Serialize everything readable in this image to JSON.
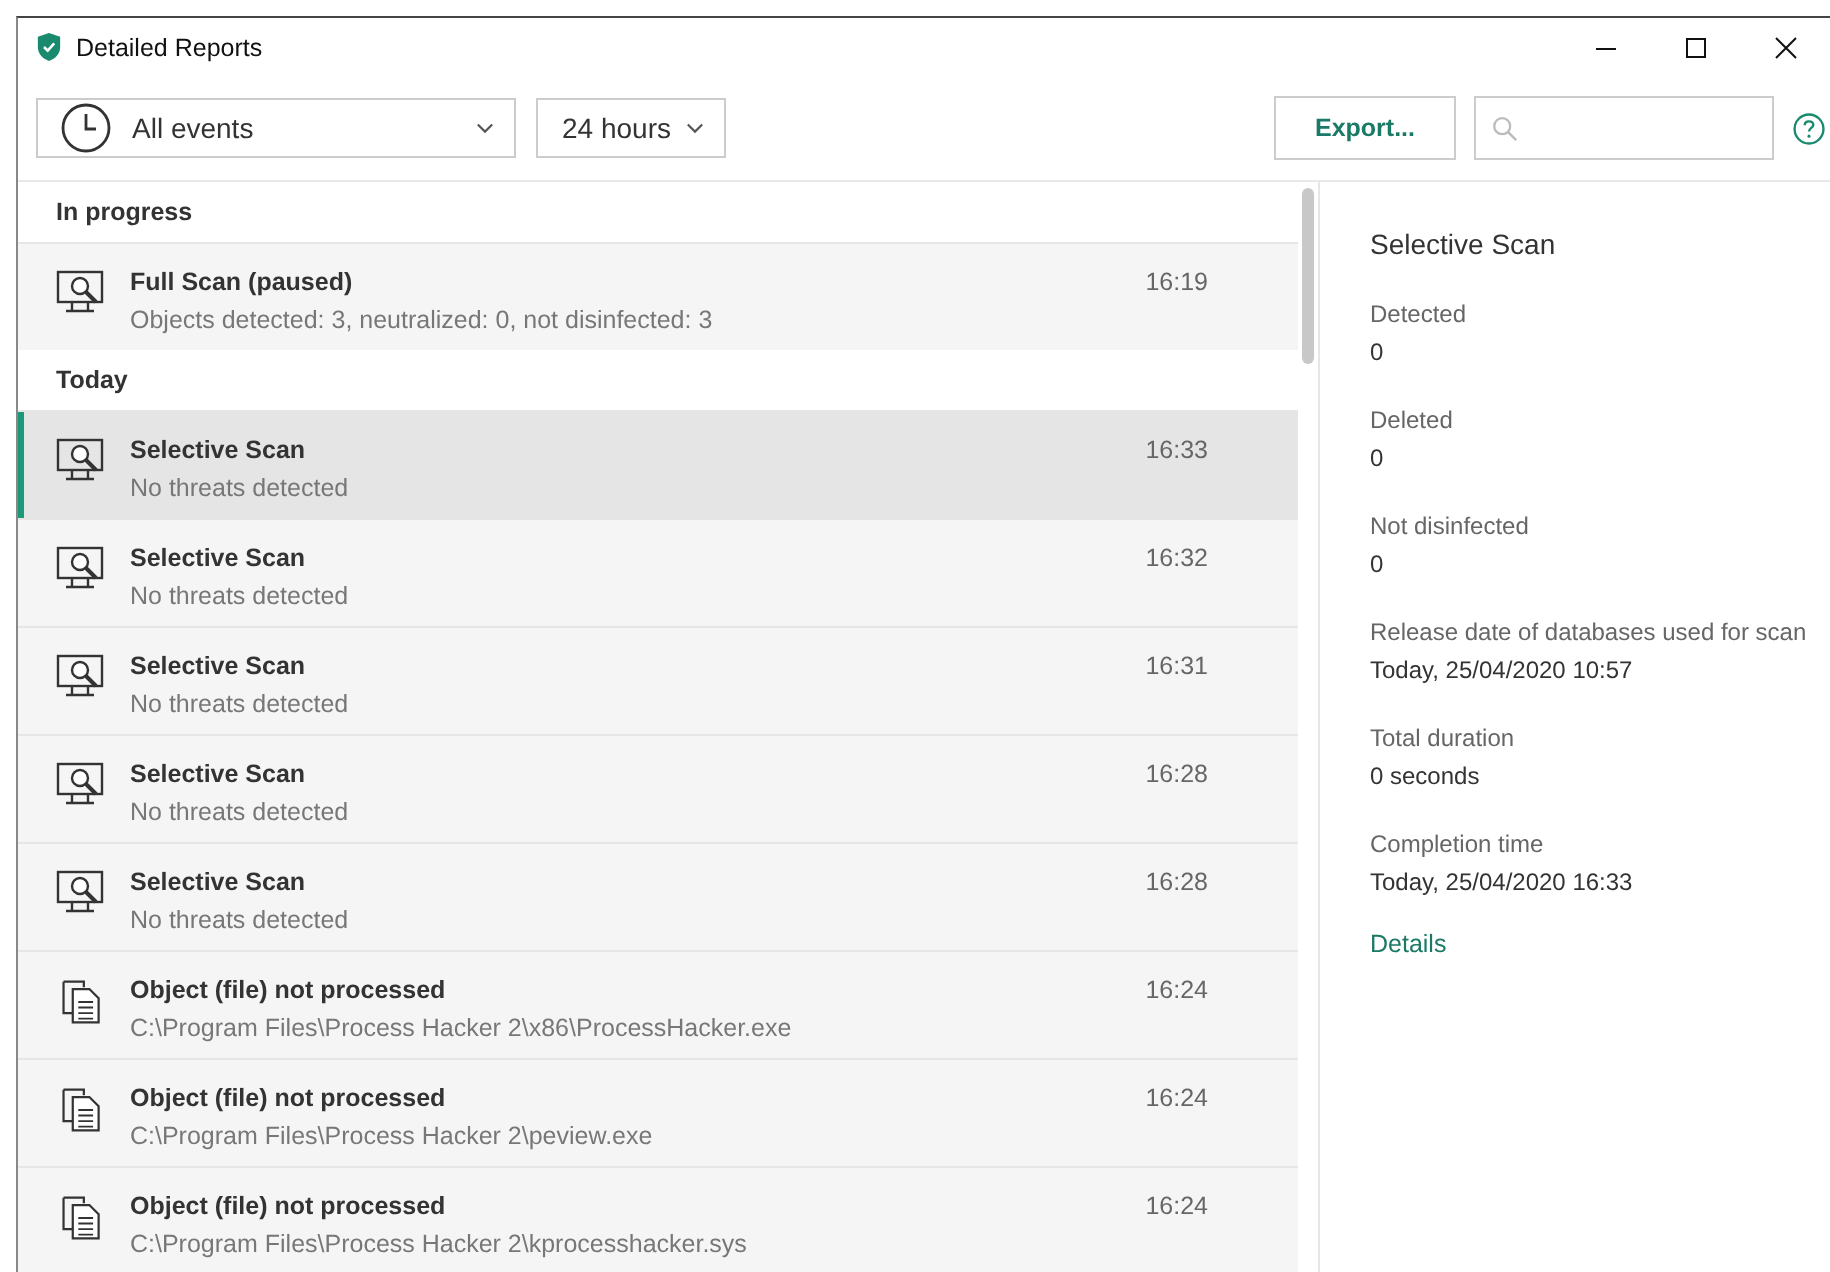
{
  "window": {
    "title": "Detailed Reports"
  },
  "toolbar": {
    "event_filter": "All events",
    "period": "24 hours",
    "export_button": "Export..."
  },
  "sections": [
    {
      "heading": "In progress",
      "items": [
        {
          "kind": "scan",
          "title": "Full Scan (paused)",
          "subtitle": "Objects detected: 3, neutralized: 0, not disinfected: 3",
          "time": "16:19",
          "selected": false
        }
      ]
    },
    {
      "heading": "Today",
      "items": [
        {
          "kind": "scan",
          "title": "Selective Scan",
          "subtitle": "No threats detected",
          "time": "16:33",
          "selected": true
        },
        {
          "kind": "scan",
          "title": "Selective Scan",
          "subtitle": "No threats detected",
          "time": "16:32",
          "selected": false
        },
        {
          "kind": "scan",
          "title": "Selective Scan",
          "subtitle": "No threats detected",
          "time": "16:31",
          "selected": false
        },
        {
          "kind": "scan",
          "title": "Selective Scan",
          "subtitle": "No threats detected",
          "time": "16:28",
          "selected": false
        },
        {
          "kind": "scan",
          "title": "Selective Scan",
          "subtitle": "No threats detected",
          "time": "16:28",
          "selected": false
        },
        {
          "kind": "file",
          "title": "Object (file) not processed",
          "subtitle": "C:\\Program Files\\Process Hacker 2\\x86\\ProcessHacker.exe",
          "time": "16:24",
          "selected": false
        },
        {
          "kind": "file",
          "title": "Object (file) not processed",
          "subtitle": "C:\\Program Files\\Process Hacker 2\\peview.exe",
          "time": "16:24",
          "selected": false
        },
        {
          "kind": "file",
          "title": "Object (file) not processed",
          "subtitle": "C:\\Program Files\\Process Hacker 2\\kprocesshacker.sys",
          "time": "16:24",
          "selected": false
        }
      ]
    }
  ],
  "details": {
    "title": "Selective Scan",
    "fields": [
      {
        "label": "Detected",
        "value": "0"
      },
      {
        "label": "Deleted",
        "value": "0"
      },
      {
        "label": "Not disinfected",
        "value": "0"
      },
      {
        "label": "Release date of databases used for scan",
        "value": "Today, 25/04/2020 10:57"
      },
      {
        "label": "Total duration",
        "value": "0 seconds"
      },
      {
        "label": "Completion time",
        "value": "Today, 25/04/2020 16:33"
      }
    ],
    "link": "Details"
  }
}
